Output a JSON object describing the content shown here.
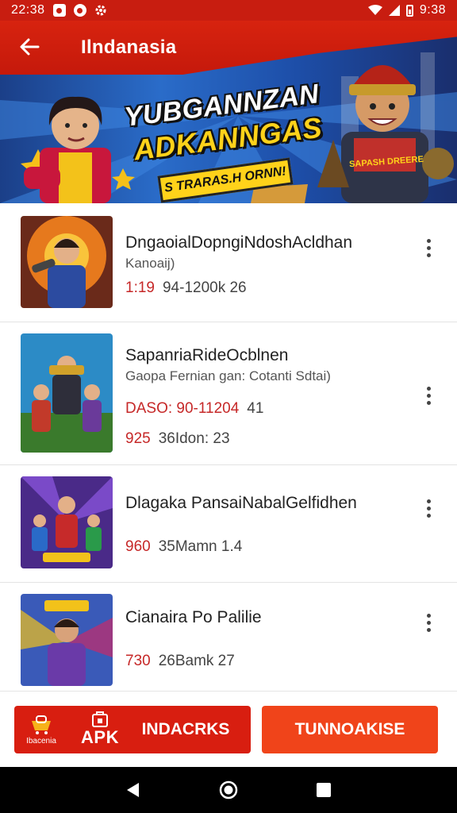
{
  "status_bar": {
    "time_left": "22:38",
    "time_right": "9:38",
    "icons": [
      "notification-icon",
      "location-icon",
      "settings-icon",
      "wifi-icon",
      "signal-icon",
      "battery-icon"
    ]
  },
  "header": {
    "title": "Ilndanasia",
    "back_icon": "arrow-left-icon"
  },
  "banner": {
    "title_line_1": "YUBGANNZAN",
    "title_line_2": "ADKANNGAS",
    "ribbon": "S TRARAS.H ORNN!",
    "badge": "SAPASH DREERE",
    "colors": {
      "sky": "#2a6cc9",
      "red": "#d7230f",
      "yellow": "#ffd21a"
    }
  },
  "apps": [
    {
      "title": "DngaoialDopngiNdoshAcldhan",
      "subtitle": "Kanoaij)",
      "rows": [
        {
          "accent": "1:19",
          "text": "94-1200k 26"
        }
      ]
    },
    {
      "title": "SapanriaRideOcblnen",
      "subtitle": "Gaopa Fernian gan: Cotanti Sdtai)",
      "rows": [
        {
          "accent": "DASO: 90-11204",
          "text": "41"
        },
        {
          "accent": "925",
          "text": "36Idon: 23"
        }
      ]
    },
    {
      "title": "Dlagaka PansaiNabalGelfidhen",
      "subtitle": "",
      "rows": [
        {
          "accent": "960",
          "text": "35Mamn 1.4"
        }
      ]
    },
    {
      "title": "Cianaira Po Palilie",
      "subtitle": "",
      "rows": [
        {
          "accent": "730",
          "text": "26Bamk 27"
        }
      ]
    }
  ],
  "action_bar": {
    "apk_small_label": "Ibacenia",
    "apk_label": "APK",
    "apk_button_label": "INDACRKS",
    "cta_button_label": "TUNNOAKISE",
    "colors": {
      "apk": "#d81e10",
      "cta": "#f0441a"
    }
  },
  "nav_bar": {
    "icons": [
      "back-triangle-icon",
      "home-circle-icon",
      "recents-square-icon"
    ]
  }
}
